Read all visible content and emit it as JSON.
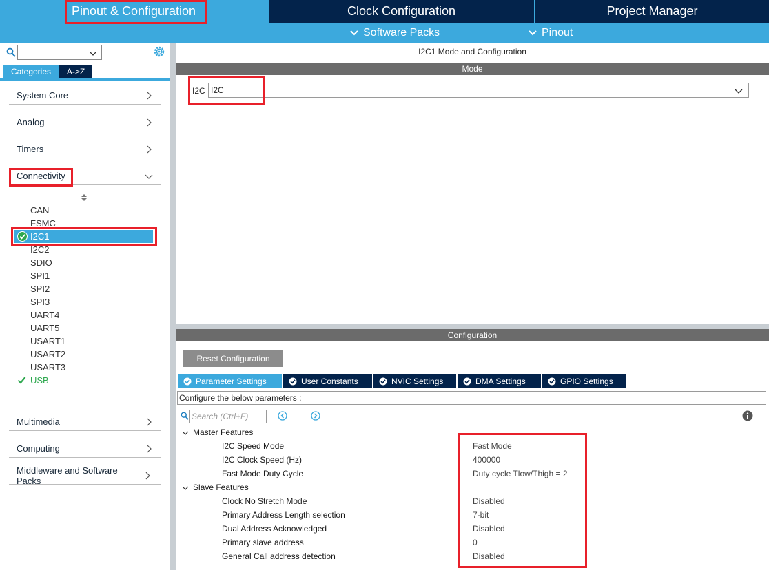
{
  "top_tabs": {
    "pinout": "Pinout & Configuration",
    "clock": "Clock Configuration",
    "project": "Project Manager"
  },
  "sub_tabs": {
    "software_packs": "Software Packs",
    "pinout": "Pinout"
  },
  "left": {
    "tabs": {
      "categories": "Categories",
      "atoz": "A->Z"
    },
    "categories": [
      {
        "label": "System Core",
        "expanded": false
      },
      {
        "label": "Analog",
        "expanded": false
      },
      {
        "label": "Timers",
        "expanded": false
      },
      {
        "label": "Connectivity",
        "expanded": true
      },
      {
        "label": "Multimedia",
        "expanded": false
      },
      {
        "label": "Computing",
        "expanded": false
      },
      {
        "label": "Middleware and Software Packs",
        "expanded": false
      }
    ],
    "connectivity_items": [
      {
        "label": "CAN",
        "status": "none"
      },
      {
        "label": "FSMC",
        "status": "none"
      },
      {
        "label": "I2C1",
        "status": "selected-checked"
      },
      {
        "label": "I2C2",
        "status": "none"
      },
      {
        "label": "SDIO",
        "status": "none"
      },
      {
        "label": "SPI1",
        "status": "none"
      },
      {
        "label": "SPI2",
        "status": "none"
      },
      {
        "label": "SPI3",
        "status": "none"
      },
      {
        "label": "UART4",
        "status": "none"
      },
      {
        "label": "UART5",
        "status": "none"
      },
      {
        "label": "USART1",
        "status": "none"
      },
      {
        "label": "USART2",
        "status": "none"
      },
      {
        "label": "USART3",
        "status": "none"
      },
      {
        "label": "USB",
        "status": "checked"
      }
    ]
  },
  "mode": {
    "title": "I2C1 Mode and Configuration",
    "header": "Mode",
    "field_label": "I2C",
    "field_value": "I2C"
  },
  "config": {
    "header": "Configuration",
    "reset_label": "Reset Configuration",
    "tabs": [
      "Parameter Settings",
      "User Constants",
      "NVIC Settings",
      "DMA Settings",
      "GPIO Settings"
    ],
    "active_tab": "Parameter Settings",
    "description": "Configure the below parameters :",
    "search_placeholder": "Search (Ctrl+F)",
    "groups": [
      {
        "label": "Master Features",
        "params": [
          {
            "name": "I2C Speed Mode",
            "value": "Fast Mode"
          },
          {
            "name": "I2C Clock Speed (Hz)",
            "value": "400000"
          },
          {
            "name": "Fast Mode Duty Cycle",
            "value": "Duty cycle Tlow/Thigh = 2"
          }
        ]
      },
      {
        "label": "Slave Features",
        "params": [
          {
            "name": "Clock No Stretch Mode",
            "value": "Disabled"
          },
          {
            "name": "Primary Address Length selection",
            "value": "7-bit"
          },
          {
            "name": "Dual Address Acknowledged",
            "value": "Disabled"
          },
          {
            "name": "Primary slave address",
            "value": "0"
          },
          {
            "name": "General Call address detection",
            "value": "Disabled"
          }
        ]
      }
    ]
  },
  "colors": {
    "accent": "#3ca9dd",
    "navy": "#03234b",
    "highlight": "#e8202a",
    "check": "#2ea84f"
  }
}
